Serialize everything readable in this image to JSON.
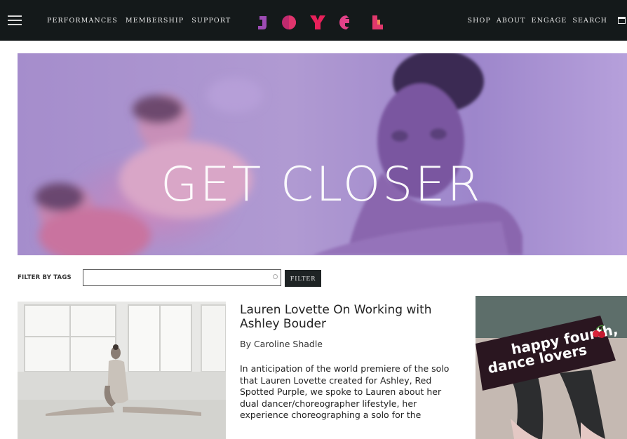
{
  "nav": {
    "left_links": [
      "PERFORMANCES",
      "MEMBERSHIP",
      "SUPPORT"
    ],
    "right_links": [
      "SHOP",
      "ABOUT",
      "ENGAGE",
      "SEARCH"
    ],
    "logo_text": "JOYCE",
    "logo_colors": [
      "#a24bb6",
      "#d9326d",
      "#e8205a",
      "#e34289",
      "#e1386c"
    ]
  },
  "hero": {
    "title": "GET CLOSER",
    "tint": "#a58dcc"
  },
  "filter": {
    "label": "FILTER BY TAGS",
    "input_value": "",
    "button_label": "FILTER"
  },
  "article": {
    "title": "Lauren Lovette On Working with Ashley Bouder",
    "author": "By Caroline Shadle",
    "excerpt": "In anticipation of the world premiere of the solo that Lauren Lovette created for Ashley, Red Spotted Purple, we spoke to Lauren about her dual dancer/choreographer lifestyle, her experience choreographing a solo for the"
  },
  "promo": {
    "text_line1": "happy fourth,",
    "text_line2": "dance lovers",
    "icon": "cherry-icon"
  }
}
